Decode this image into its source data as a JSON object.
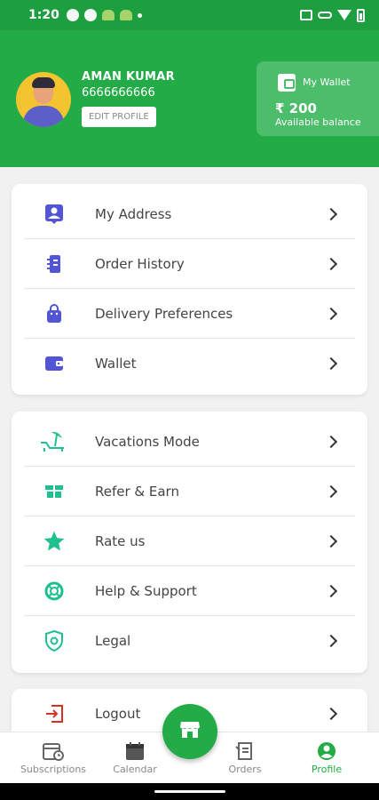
{
  "status_bar": {
    "time": "1:20"
  },
  "profile": {
    "name": "AMAN KUMAR",
    "phone": "6666666666",
    "edit_label": "EDIT PROFILE"
  },
  "wallet": {
    "title": "My Wallet",
    "amount": "₹ 200",
    "label": "Available balance"
  },
  "menu_group_1": [
    {
      "label": "My Address",
      "icon": "address-icon"
    },
    {
      "label": "Order History",
      "icon": "order-history-icon"
    },
    {
      "label": "Delivery Preferences",
      "icon": "bag-icon"
    },
    {
      "label": "Wallet",
      "icon": "wallet-icon"
    }
  ],
  "menu_group_2": [
    {
      "label": "Vacations Mode",
      "icon": "beach-umbrella-icon"
    },
    {
      "label": "Refer & Earn",
      "icon": "gift-icon"
    },
    {
      "label": "Rate us",
      "icon": "star-icon"
    },
    {
      "label": "Help & Support",
      "icon": "lifebuoy-icon"
    },
    {
      "label": "Legal",
      "icon": "shield-icon"
    }
  ],
  "logout": {
    "label": "Logout",
    "icon": "logout-icon"
  },
  "bottom_nav": {
    "subscriptions": "Subscriptions",
    "calendar": "Calendar",
    "orders": "Orders",
    "profile": "Profile",
    "active": "profile"
  },
  "colors": {
    "primary_green": "#23ab47",
    "blue_icon": "#5155d6",
    "teal_icon": "#1fbf8f",
    "logout_red": "#d93025"
  }
}
